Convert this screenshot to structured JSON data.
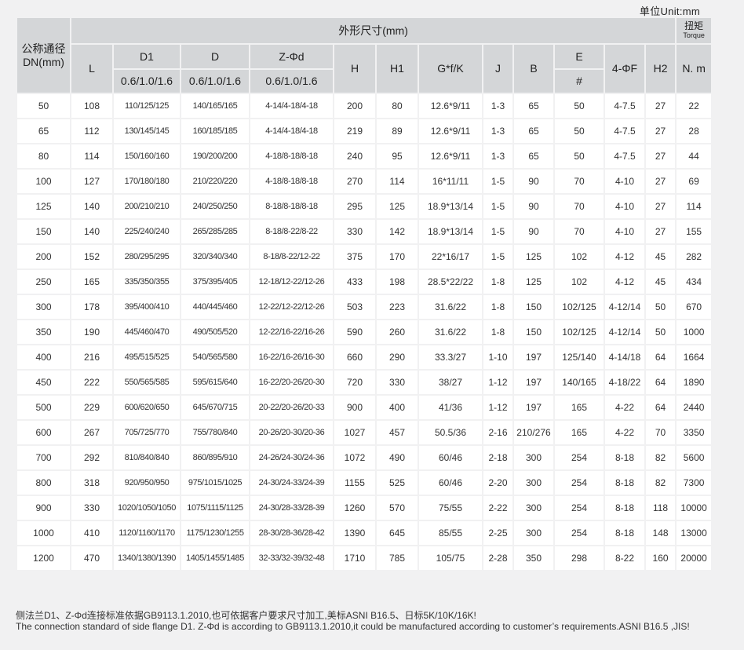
{
  "unit_note": "单位Unit:mm",
  "header": {
    "dn": "公称通径DN(mm)",
    "overall": "外形尺寸(mm)",
    "torque_zh": "扭矩",
    "torque_en": "Torque",
    "L": "L",
    "D1": "D1",
    "D1_sub": "0.6/1.0/1.6",
    "D": "D",
    "D_sub": "0.6/1.0/1.6",
    "Zd": "Z-Φd",
    "Zd_sub": "0.6/1.0/1.6",
    "H": "H",
    "H1": "H1",
    "GfK": "G*f/K",
    "J": "J",
    "B": "B",
    "E": "E",
    "E_sub": "#",
    "F": "4-ΦF",
    "H2": "H2",
    "Nm": "N. m"
  },
  "rows": [
    [
      "50",
      "108",
      "110/125/125",
      "140/165/165",
      "4-14/4-18/4-18",
      "200",
      "80",
      "12.6*9/11",
      "1-3",
      "65",
      "50",
      "4-7.5",
      "27",
      "22"
    ],
    [
      "65",
      "112",
      "130/145/145",
      "160/185/185",
      "4-14/4-18/4-18",
      "219",
      "89",
      "12.6*9/11",
      "1-3",
      "65",
      "50",
      "4-7.5",
      "27",
      "28"
    ],
    [
      "80",
      "114",
      "150/160/160",
      "190/200/200",
      "4-18/8-18/8-18",
      "240",
      "95",
      "12.6*9/11",
      "1-3",
      "65",
      "50",
      "4-7.5",
      "27",
      "44"
    ],
    [
      "100",
      "127",
      "170/180/180",
      "210/220/220",
      "4-18/8-18/8-18",
      "270",
      "114",
      "16*11/11",
      "1-5",
      "90",
      "70",
      "4-10",
      "27",
      "69"
    ],
    [
      "125",
      "140",
      "200/210/210",
      "240/250/250",
      "8-18/8-18/8-18",
      "295",
      "125",
      "18.9*13/14",
      "1-5",
      "90",
      "70",
      "4-10",
      "27",
      "114"
    ],
    [
      "150",
      "140",
      "225/240/240",
      "265/285/285",
      "8-18/8-22/8-22",
      "330",
      "142",
      "18.9*13/14",
      "1-5",
      "90",
      "70",
      "4-10",
      "27",
      "155"
    ],
    [
      "200",
      "152",
      "280/295/295",
      "320/340/340",
      "8-18/8-22/12-22",
      "375",
      "170",
      "22*16/17",
      "1-5",
      "125",
      "102",
      "4-12",
      "45",
      "282"
    ],
    [
      "250",
      "165",
      "335/350/355",
      "375/395/405",
      "12-18/12-22/12-26",
      "433",
      "198",
      "28.5*22/22",
      "1-8",
      "125",
      "102",
      "4-12",
      "45",
      "434"
    ],
    [
      "300",
      "178",
      "395/400/410",
      "440/445/460",
      "12-22/12-22/12-26",
      "503",
      "223",
      "31.6/22",
      "1-8",
      "150",
      "102/125",
      "4-12/14",
      "50",
      "670"
    ],
    [
      "350",
      "190",
      "445/460/470",
      "490/505/520",
      "12-22/16-22/16-26",
      "590",
      "260",
      "31.6/22",
      "1-8",
      "150",
      "102/125",
      "4-12/14",
      "50",
      "1000"
    ],
    [
      "400",
      "216",
      "495/515/525",
      "540/565/580",
      "16-22/16-26/16-30",
      "660",
      "290",
      "33.3/27",
      "1-10",
      "197",
      "125/140",
      "4-14/18",
      "64",
      "1664"
    ],
    [
      "450",
      "222",
      "550/565/585",
      "595/615/640",
      "16-22/20-26/20-30",
      "720",
      "330",
      "38/27",
      "1-12",
      "197",
      "140/165",
      "4-18/22",
      "64",
      "1890"
    ],
    [
      "500",
      "229",
      "600/620/650",
      "645/670/715",
      "20-22/20-26/20-33",
      "900",
      "400",
      "41/36",
      "1-12",
      "197",
      "165",
      "4-22",
      "64",
      "2440"
    ],
    [
      "600",
      "267",
      "705/725/770",
      "755/780/840",
      "20-26/20-30/20-36",
      "1027",
      "457",
      "50.5/36",
      "2-16",
      "210/276",
      "165",
      "4-22",
      "70",
      "3350"
    ],
    [
      "700",
      "292",
      "810/840/840",
      "860/895/910",
      "24-26/24-30/24-36",
      "1072",
      "490",
      "60/46",
      "2-18",
      "300",
      "254",
      "8-18",
      "82",
      "5600"
    ],
    [
      "800",
      "318",
      "920/950/950",
      "975/1015/1025",
      "24-30/24-33/24-39",
      "1155",
      "525",
      "60/46",
      "2-20",
      "300",
      "254",
      "8-18",
      "82",
      "7300"
    ],
    [
      "900",
      "330",
      "1020/1050/1050",
      "1075/1115/1125",
      "24-30/28-33/28-39",
      "1260",
      "570",
      "75/55",
      "2-22",
      "300",
      "254",
      "8-18",
      "118",
      "10000"
    ],
    [
      "1000",
      "410",
      "1120/1160/1170",
      "1175/1230/1255",
      "28-30/28-36/28-42",
      "1390",
      "645",
      "85/55",
      "2-25",
      "300",
      "254",
      "8-18",
      "148",
      "13000"
    ],
    [
      "1200",
      "470",
      "1340/1380/1390",
      "1405/1455/1485",
      "32-33/32-39/32-48",
      "1710",
      "785",
      "105/75",
      "2-28",
      "350",
      "298",
      "8-22",
      "160",
      "20000"
    ]
  ],
  "footnote_zh": "侧法兰D1、Z-Φd连接标准依据GB9113.1.2010,也可依据客户要求尺寸加工,美标ASNI B16.5、日标5K/10K/16K!",
  "footnote_en": "The connection standard of side flange D1. Z-Φd  is according to GB9113.1.2010,it  could be manufactured according to customer’s requirements.ASNI B16.5 ,JIS!"
}
